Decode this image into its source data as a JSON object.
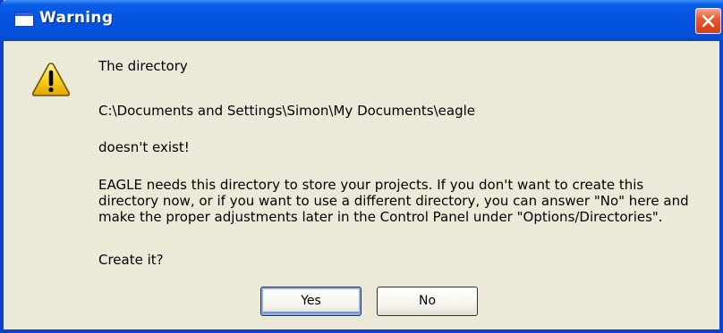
{
  "window": {
    "title": "Warning"
  },
  "message": {
    "line1": "The directory",
    "path": "C:\\Documents and Settings\\Simon\\My Documents\\eagle",
    "line3": "doesn't exist!",
    "paragraph": [
      "EAGLE needs this directory to store your projects. If you don't want to create this",
      "directory now, or if you want to use a different directory, you can answer \"No\" here and",
      "make the proper adjustments later in the Control Panel under \"Options/Directories\"."
    ],
    "question": "Create it?"
  },
  "buttons": {
    "yes_label": "Yes",
    "no_label": "No"
  },
  "icons": {
    "window_icon": "window-icon",
    "close": "close-icon",
    "warning": "warning-icon"
  },
  "colors": {
    "titlebar": "#0554e3",
    "dialog_bg": "#ece9d8",
    "close_button": "#d23d18",
    "warning_yellow": "#f7d21c"
  }
}
